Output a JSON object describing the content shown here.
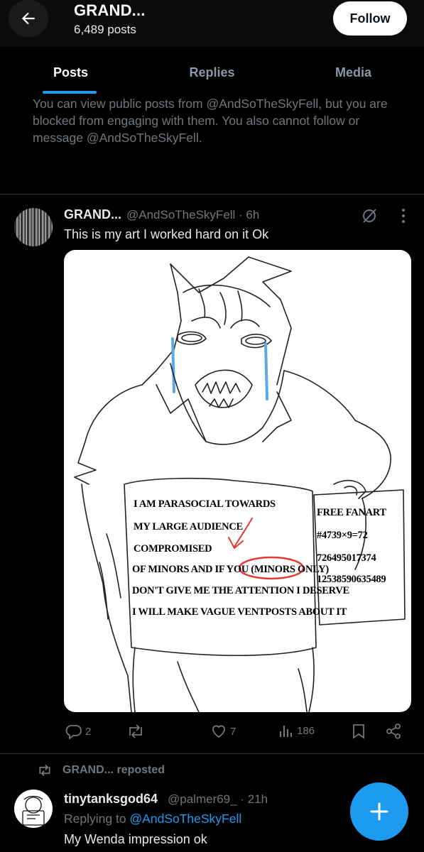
{
  "header": {
    "title": "GRAND...",
    "post_count": "6,489 posts",
    "follow_label": "Follow"
  },
  "tabs": [
    {
      "label": "Posts",
      "active": true
    },
    {
      "label": "Replies",
      "active": false
    },
    {
      "label": "Media",
      "active": false
    }
  ],
  "notice": "You can view public posts from @AndSoTheSkyFell, but you are blocked from engaging with them. You also cannot follow or message @AndSoTheSkyFell.",
  "tweet1": {
    "name": "GRAND...",
    "handle_time": "@AndSoTheSkyFell · 6h",
    "text": "This is my art I worked hard on it Ok",
    "art_lines": [
      "I AM PARASOCIAL TOWARDS",
      "MY LARGE AUDIENCE",
      "COMPROMISED",
      "OF MINORS AND IF YOU (MINORS ONLY)",
      "DON'T GIVE ME THE ATTENTION I DESERVE",
      "I WILL MAKE VAGUE VENTPOSTS ABOUT IT"
    ],
    "sign_lines": [
      "FREE FANART",
      "#4739×9=72",
      "726495017374",
      "12538590635489"
    ],
    "replies": "2",
    "reposts": "",
    "likes": "7",
    "views": "186"
  },
  "repost_label": "GRAND... reposted",
  "tweet2": {
    "name": "tinytanksgod64",
    "handle_time": "@palmer69_ · 21h",
    "reply_prefix": "Replying to ",
    "reply_to": "@AndSoTheSkyFell",
    "text": "My Wenda impression ok"
  },
  "colors": {
    "accent": "#1d9bf0",
    "muted": "#71767b",
    "background": "#000000"
  }
}
